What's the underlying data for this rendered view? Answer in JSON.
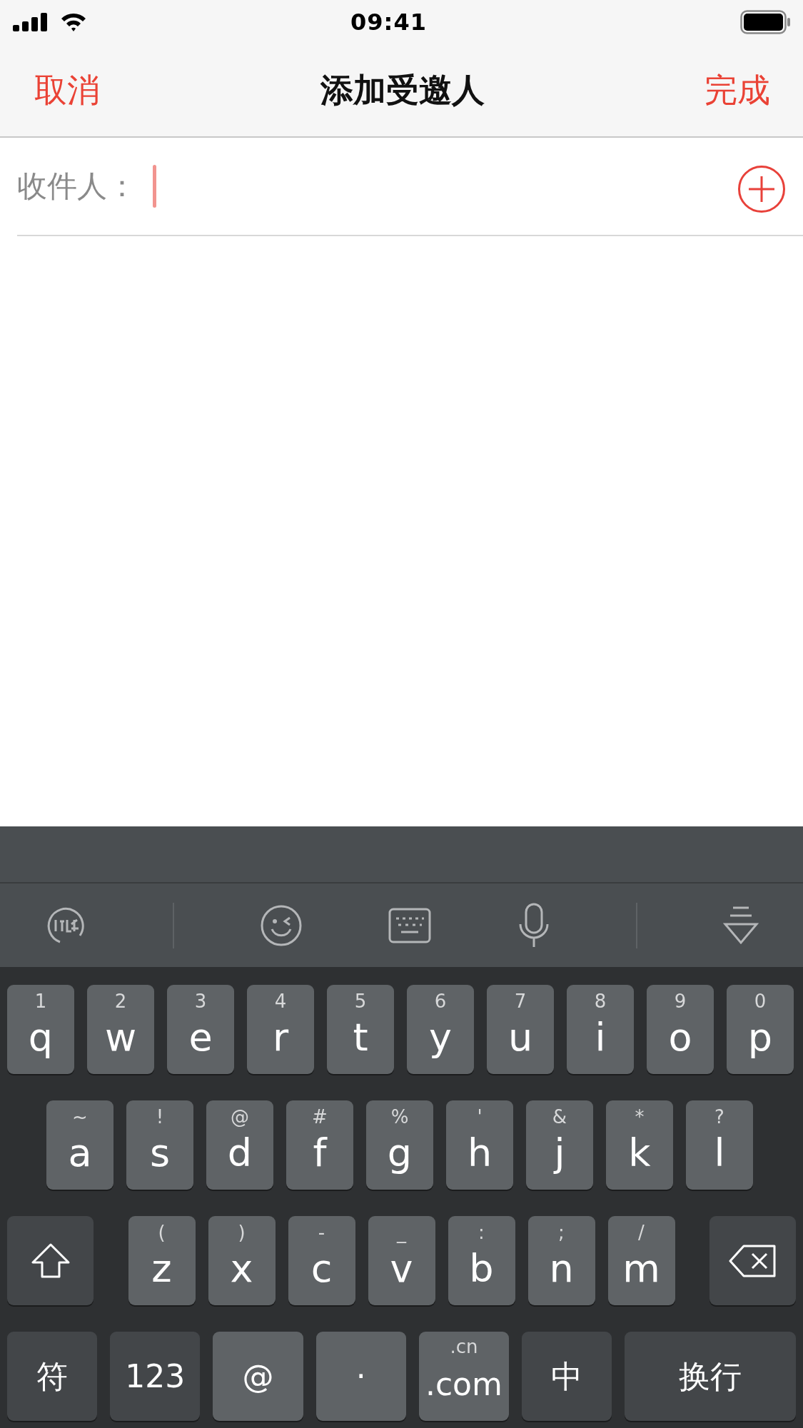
{
  "status_bar": {
    "time": "09:41"
  },
  "nav_bar": {
    "cancel": "取消",
    "title": "添加受邀人",
    "done": "完成"
  },
  "recipient_field": {
    "label": "收件人："
  },
  "keyboard": {
    "rows": [
      {
        "keys": [
          {
            "kind": "letter",
            "label": "q",
            "hint": "1"
          },
          {
            "kind": "letter",
            "label": "w",
            "hint": "2"
          },
          {
            "kind": "letter",
            "label": "e",
            "hint": "3"
          },
          {
            "kind": "letter",
            "label": "r",
            "hint": "4"
          },
          {
            "kind": "letter",
            "label": "t",
            "hint": "5"
          },
          {
            "kind": "letter",
            "label": "y",
            "hint": "6"
          },
          {
            "kind": "letter",
            "label": "u",
            "hint": "7"
          },
          {
            "kind": "letter",
            "label": "i",
            "hint": "8"
          },
          {
            "kind": "letter",
            "label": "o",
            "hint": "9"
          },
          {
            "kind": "letter",
            "label": "p",
            "hint": "0"
          }
        ]
      },
      {
        "keys": [
          {
            "kind": "letter",
            "label": "a",
            "hint": "~"
          },
          {
            "kind": "letter",
            "label": "s",
            "hint": "!"
          },
          {
            "kind": "letter",
            "label": "d",
            "hint": "@"
          },
          {
            "kind": "letter",
            "label": "f",
            "hint": "#"
          },
          {
            "kind": "letter",
            "label": "g",
            "hint": "%"
          },
          {
            "kind": "letter",
            "label": "h",
            "hint": "'"
          },
          {
            "kind": "letter",
            "label": "j",
            "hint": "&"
          },
          {
            "kind": "letter",
            "label": "k",
            "hint": "*"
          },
          {
            "kind": "letter",
            "label": "l",
            "hint": "?"
          }
        ]
      },
      {
        "keys": [
          {
            "kind": "shift"
          },
          {
            "kind": "letter",
            "label": "z",
            "hint": "("
          },
          {
            "kind": "letter",
            "label": "x",
            "hint": ")"
          },
          {
            "kind": "letter",
            "label": "c",
            "hint": "-"
          },
          {
            "kind": "letter",
            "label": "v",
            "hint": "_"
          },
          {
            "kind": "letter",
            "label": "b",
            "hint": ":"
          },
          {
            "kind": "letter",
            "label": "n",
            "hint": ";"
          },
          {
            "kind": "letter",
            "label": "m",
            "hint": "/"
          },
          {
            "kind": "delete"
          }
        ]
      },
      {
        "keys": [
          {
            "kind": "mode",
            "label": "符"
          },
          {
            "kind": "mode",
            "label": "123"
          },
          {
            "kind": "symbol",
            "label": "@"
          },
          {
            "kind": "symbol",
            "label": "·"
          },
          {
            "kind": "symbol",
            "label": ".com",
            "hint": ".cn"
          },
          {
            "kind": "mode",
            "label": "中"
          },
          {
            "kind": "return",
            "label": "换行"
          }
        ]
      }
    ]
  }
}
